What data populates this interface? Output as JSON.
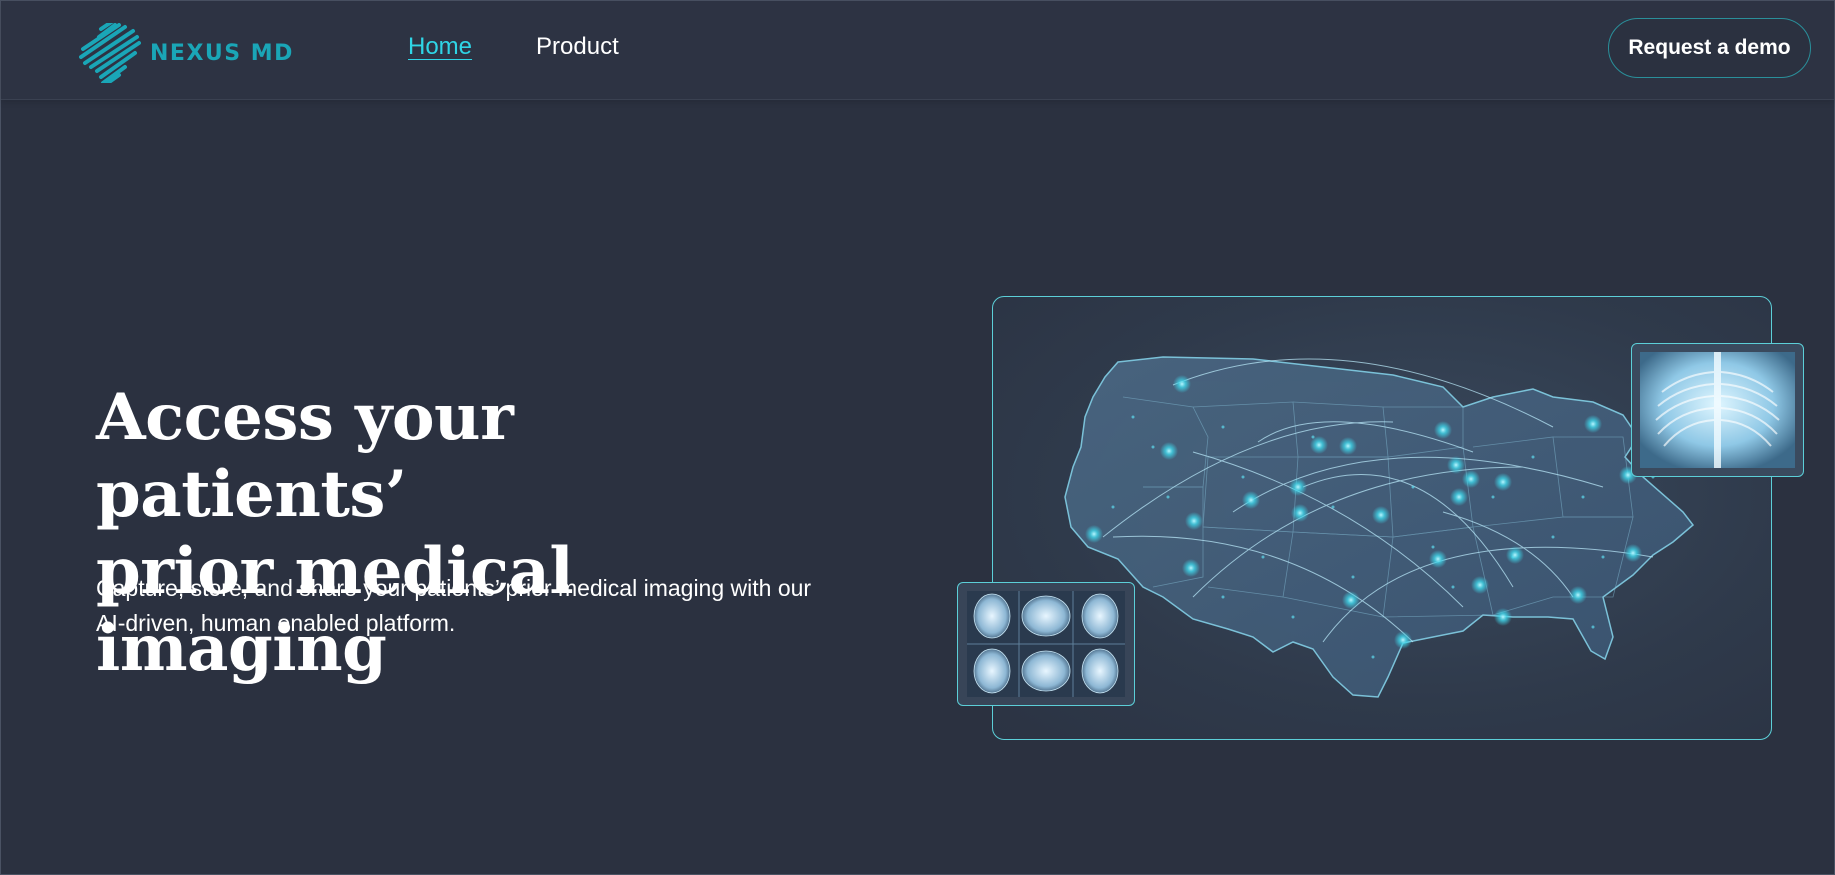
{
  "header": {
    "logo_text": "NEXUS MD",
    "nav": [
      {
        "label": "Home",
        "active": true
      },
      {
        "label": "Product",
        "active": false
      }
    ],
    "cta_label": "Request a demo"
  },
  "hero": {
    "title_line1": "Access your patients’",
    "title_line2": "prior medical imaging",
    "subtitle_line1": "Capture, store, and share your patients’ prior medical imaging with our",
    "subtitle_line2": "AI-driven, human enabled platform."
  },
  "colors": {
    "background": "#2b3140",
    "accent": "#2fd5e6",
    "logo": "#1aa6b7",
    "card_border": "#5ccfd8"
  },
  "icons": [
    "nexus-md-logo-icon",
    "us-map-network-illustration",
    "chest-xray-image",
    "brain-mri-grid-image"
  ]
}
